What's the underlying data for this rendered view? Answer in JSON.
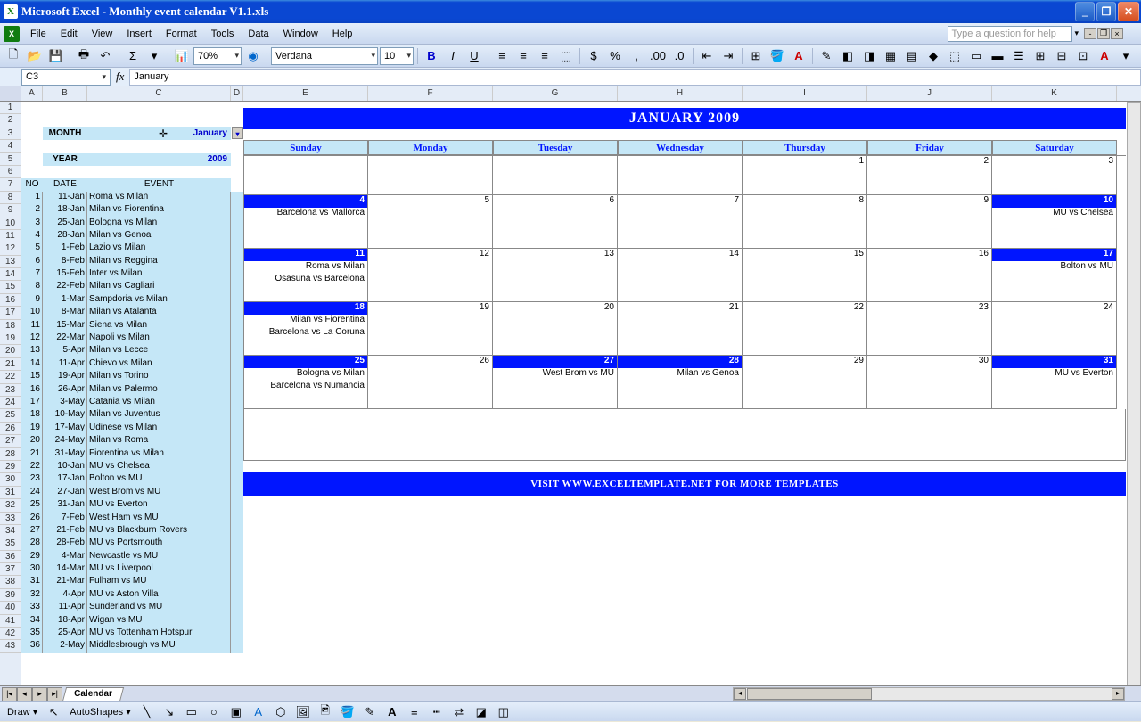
{
  "title": "Microsoft Excel - Monthly event calendar V1.1.xls",
  "menus": {
    "file": "File",
    "edit": "Edit",
    "view": "View",
    "insert": "Insert",
    "format": "Format",
    "tools": "Tools",
    "data": "Data",
    "window": "Window",
    "help": "Help"
  },
  "helpPlaceholder": "Type a question for help",
  "toolbar": {
    "zoom": "70%",
    "font": "Verdana",
    "size": "10"
  },
  "namebox": "C3",
  "formula": "January",
  "cols": [
    "A",
    "B",
    "C",
    "D",
    "E",
    "F",
    "G",
    "H",
    "I",
    "J",
    "K"
  ],
  "rows": [
    "1",
    "2",
    "3",
    "4",
    "5",
    "6",
    "7",
    "8",
    "9",
    "10",
    "11",
    "12",
    "13",
    "14",
    "15",
    "16",
    "17",
    "18",
    "19",
    "20",
    "21",
    "22",
    "23",
    "24",
    "25",
    "26",
    "27",
    "28",
    "29",
    "30",
    "31",
    "32",
    "33",
    "34",
    "35",
    "36",
    "37",
    "38",
    "39",
    "40",
    "41",
    "42",
    "43"
  ],
  "panel": {
    "monthLabel": "MONTH",
    "monthVal": "January",
    "yearLabel": "YEAR",
    "yearVal": "2009",
    "hNo": "NO",
    "hDate": "DATE",
    "hEvent": "EVENT"
  },
  "events": [
    {
      "n": "1",
      "d": "11-Jan",
      "e": "Roma vs Milan"
    },
    {
      "n": "2",
      "d": "18-Jan",
      "e": "Milan vs Fiorentina"
    },
    {
      "n": "3",
      "d": "25-Jan",
      "e": "Bologna vs Milan"
    },
    {
      "n": "4",
      "d": "28-Jan",
      "e": "Milan vs Genoa"
    },
    {
      "n": "5",
      "d": "1-Feb",
      "e": "Lazio vs Milan"
    },
    {
      "n": "6",
      "d": "8-Feb",
      "e": "Milan vs Reggina"
    },
    {
      "n": "7",
      "d": "15-Feb",
      "e": "Inter vs Milan"
    },
    {
      "n": "8",
      "d": "22-Feb",
      "e": "Milan vs Cagliari"
    },
    {
      "n": "9",
      "d": "1-Mar",
      "e": "Sampdoria vs Milan"
    },
    {
      "n": "10",
      "d": "8-Mar",
      "e": "Milan vs Atalanta"
    },
    {
      "n": "11",
      "d": "15-Mar",
      "e": "Siena vs Milan"
    },
    {
      "n": "12",
      "d": "22-Mar",
      "e": "Napoli vs Milan"
    },
    {
      "n": "13",
      "d": "5-Apr",
      "e": "Milan vs Lecce"
    },
    {
      "n": "14",
      "d": "11-Apr",
      "e": "Chievo vs Milan"
    },
    {
      "n": "15",
      "d": "19-Apr",
      "e": "Milan vs Torino"
    },
    {
      "n": "16",
      "d": "26-Apr",
      "e": "Milan vs Palermo"
    },
    {
      "n": "17",
      "d": "3-May",
      "e": "Catania vs Milan"
    },
    {
      "n": "18",
      "d": "10-May",
      "e": "Milan vs Juventus"
    },
    {
      "n": "19",
      "d": "17-May",
      "e": "Udinese vs Milan"
    },
    {
      "n": "20",
      "d": "24-May",
      "e": "Milan vs Roma"
    },
    {
      "n": "21",
      "d": "31-May",
      "e": "Fiorentina vs Milan"
    },
    {
      "n": "22",
      "d": "10-Jan",
      "e": "MU vs Chelsea"
    },
    {
      "n": "23",
      "d": "17-Jan",
      "e": "Bolton vs MU"
    },
    {
      "n": "24",
      "d": "27-Jan",
      "e": "West Brom vs MU"
    },
    {
      "n": "25",
      "d": "31-Jan",
      "e": "MU vs Everton"
    },
    {
      "n": "26",
      "d": "7-Feb",
      "e": "West Ham vs MU"
    },
    {
      "n": "27",
      "d": "21-Feb",
      "e": "MU vs Blackburn Rovers"
    },
    {
      "n": "28",
      "d": "28-Feb",
      "e": "MU vs Portsmouth"
    },
    {
      "n": "29",
      "d": "4-Mar",
      "e": "Newcastle vs MU"
    },
    {
      "n": "30",
      "d": "14-Mar",
      "e": "MU vs Liverpool"
    },
    {
      "n": "31",
      "d": "21-Mar",
      "e": "Fulham vs MU"
    },
    {
      "n": "32",
      "d": "4-Apr",
      "e": "MU vs Aston Villa"
    },
    {
      "n": "33",
      "d": "11-Apr",
      "e": "Sunderland vs MU"
    },
    {
      "n": "34",
      "d": "18-Apr",
      "e": "Wigan vs MU"
    },
    {
      "n": "35",
      "d": "25-Apr",
      "e": "MU vs Tottenham Hotspur"
    },
    {
      "n": "36",
      "d": "2-May",
      "e": "Middlesbrough vs MU"
    }
  ],
  "calendar": {
    "title": "JANUARY 2009",
    "days": [
      "Sunday",
      "Monday",
      "Tuesday",
      "Wednesday",
      "Thursday",
      "Friday",
      "Saturday"
    ],
    "weeks": [
      [
        {
          "n": "",
          "hl": false,
          "ev": []
        },
        {
          "n": "",
          "hl": false,
          "ev": []
        },
        {
          "n": "",
          "hl": false,
          "ev": []
        },
        {
          "n": "",
          "hl": false,
          "ev": []
        },
        {
          "n": "1",
          "hl": false,
          "ev": []
        },
        {
          "n": "2",
          "hl": false,
          "ev": []
        },
        {
          "n": "3",
          "hl": false,
          "ev": []
        }
      ],
      [
        {
          "n": "4",
          "hl": true,
          "ev": [
            "Barcelona vs Mallorca"
          ]
        },
        {
          "n": "5",
          "hl": false,
          "ev": []
        },
        {
          "n": "6",
          "hl": false,
          "ev": []
        },
        {
          "n": "7",
          "hl": false,
          "ev": []
        },
        {
          "n": "8",
          "hl": false,
          "ev": []
        },
        {
          "n": "9",
          "hl": false,
          "ev": []
        },
        {
          "n": "10",
          "hl": true,
          "ev": [
            "MU vs Chelsea"
          ]
        }
      ],
      [
        {
          "n": "11",
          "hl": true,
          "ev": [
            "Roma vs Milan",
            "Osasuna vs Barcelona"
          ]
        },
        {
          "n": "12",
          "hl": false,
          "ev": []
        },
        {
          "n": "13",
          "hl": false,
          "ev": []
        },
        {
          "n": "14",
          "hl": false,
          "ev": []
        },
        {
          "n": "15",
          "hl": false,
          "ev": []
        },
        {
          "n": "16",
          "hl": false,
          "ev": []
        },
        {
          "n": "17",
          "hl": true,
          "ev": [
            "Bolton vs MU"
          ]
        }
      ],
      [
        {
          "n": "18",
          "hl": true,
          "ev": [
            "Milan vs Fiorentina",
            "Barcelona vs La Coruna"
          ]
        },
        {
          "n": "19",
          "hl": false,
          "ev": []
        },
        {
          "n": "20",
          "hl": false,
          "ev": []
        },
        {
          "n": "21",
          "hl": false,
          "ev": []
        },
        {
          "n": "22",
          "hl": false,
          "ev": []
        },
        {
          "n": "23",
          "hl": false,
          "ev": []
        },
        {
          "n": "24",
          "hl": false,
          "ev": []
        }
      ],
      [
        {
          "n": "25",
          "hl": true,
          "ev": [
            "Bologna vs Milan",
            "Barcelona vs Numancia"
          ]
        },
        {
          "n": "26",
          "hl": false,
          "ev": []
        },
        {
          "n": "27",
          "hl": true,
          "ev": [
            "West Brom vs MU"
          ]
        },
        {
          "n": "28",
          "hl": true,
          "ev": [
            "Milan vs Genoa"
          ]
        },
        {
          "n": "29",
          "hl": false,
          "ev": []
        },
        {
          "n": "30",
          "hl": false,
          "ev": []
        },
        {
          "n": "31",
          "hl": true,
          "ev": [
            "MU vs Everton"
          ]
        }
      ]
    ],
    "footer": "VISIT WWW.EXCELTEMPLATE.NET FOR MORE TEMPLATES"
  },
  "tab": "Calendar",
  "status": {
    "draw": "Draw",
    "autoshapes": "AutoShapes"
  }
}
